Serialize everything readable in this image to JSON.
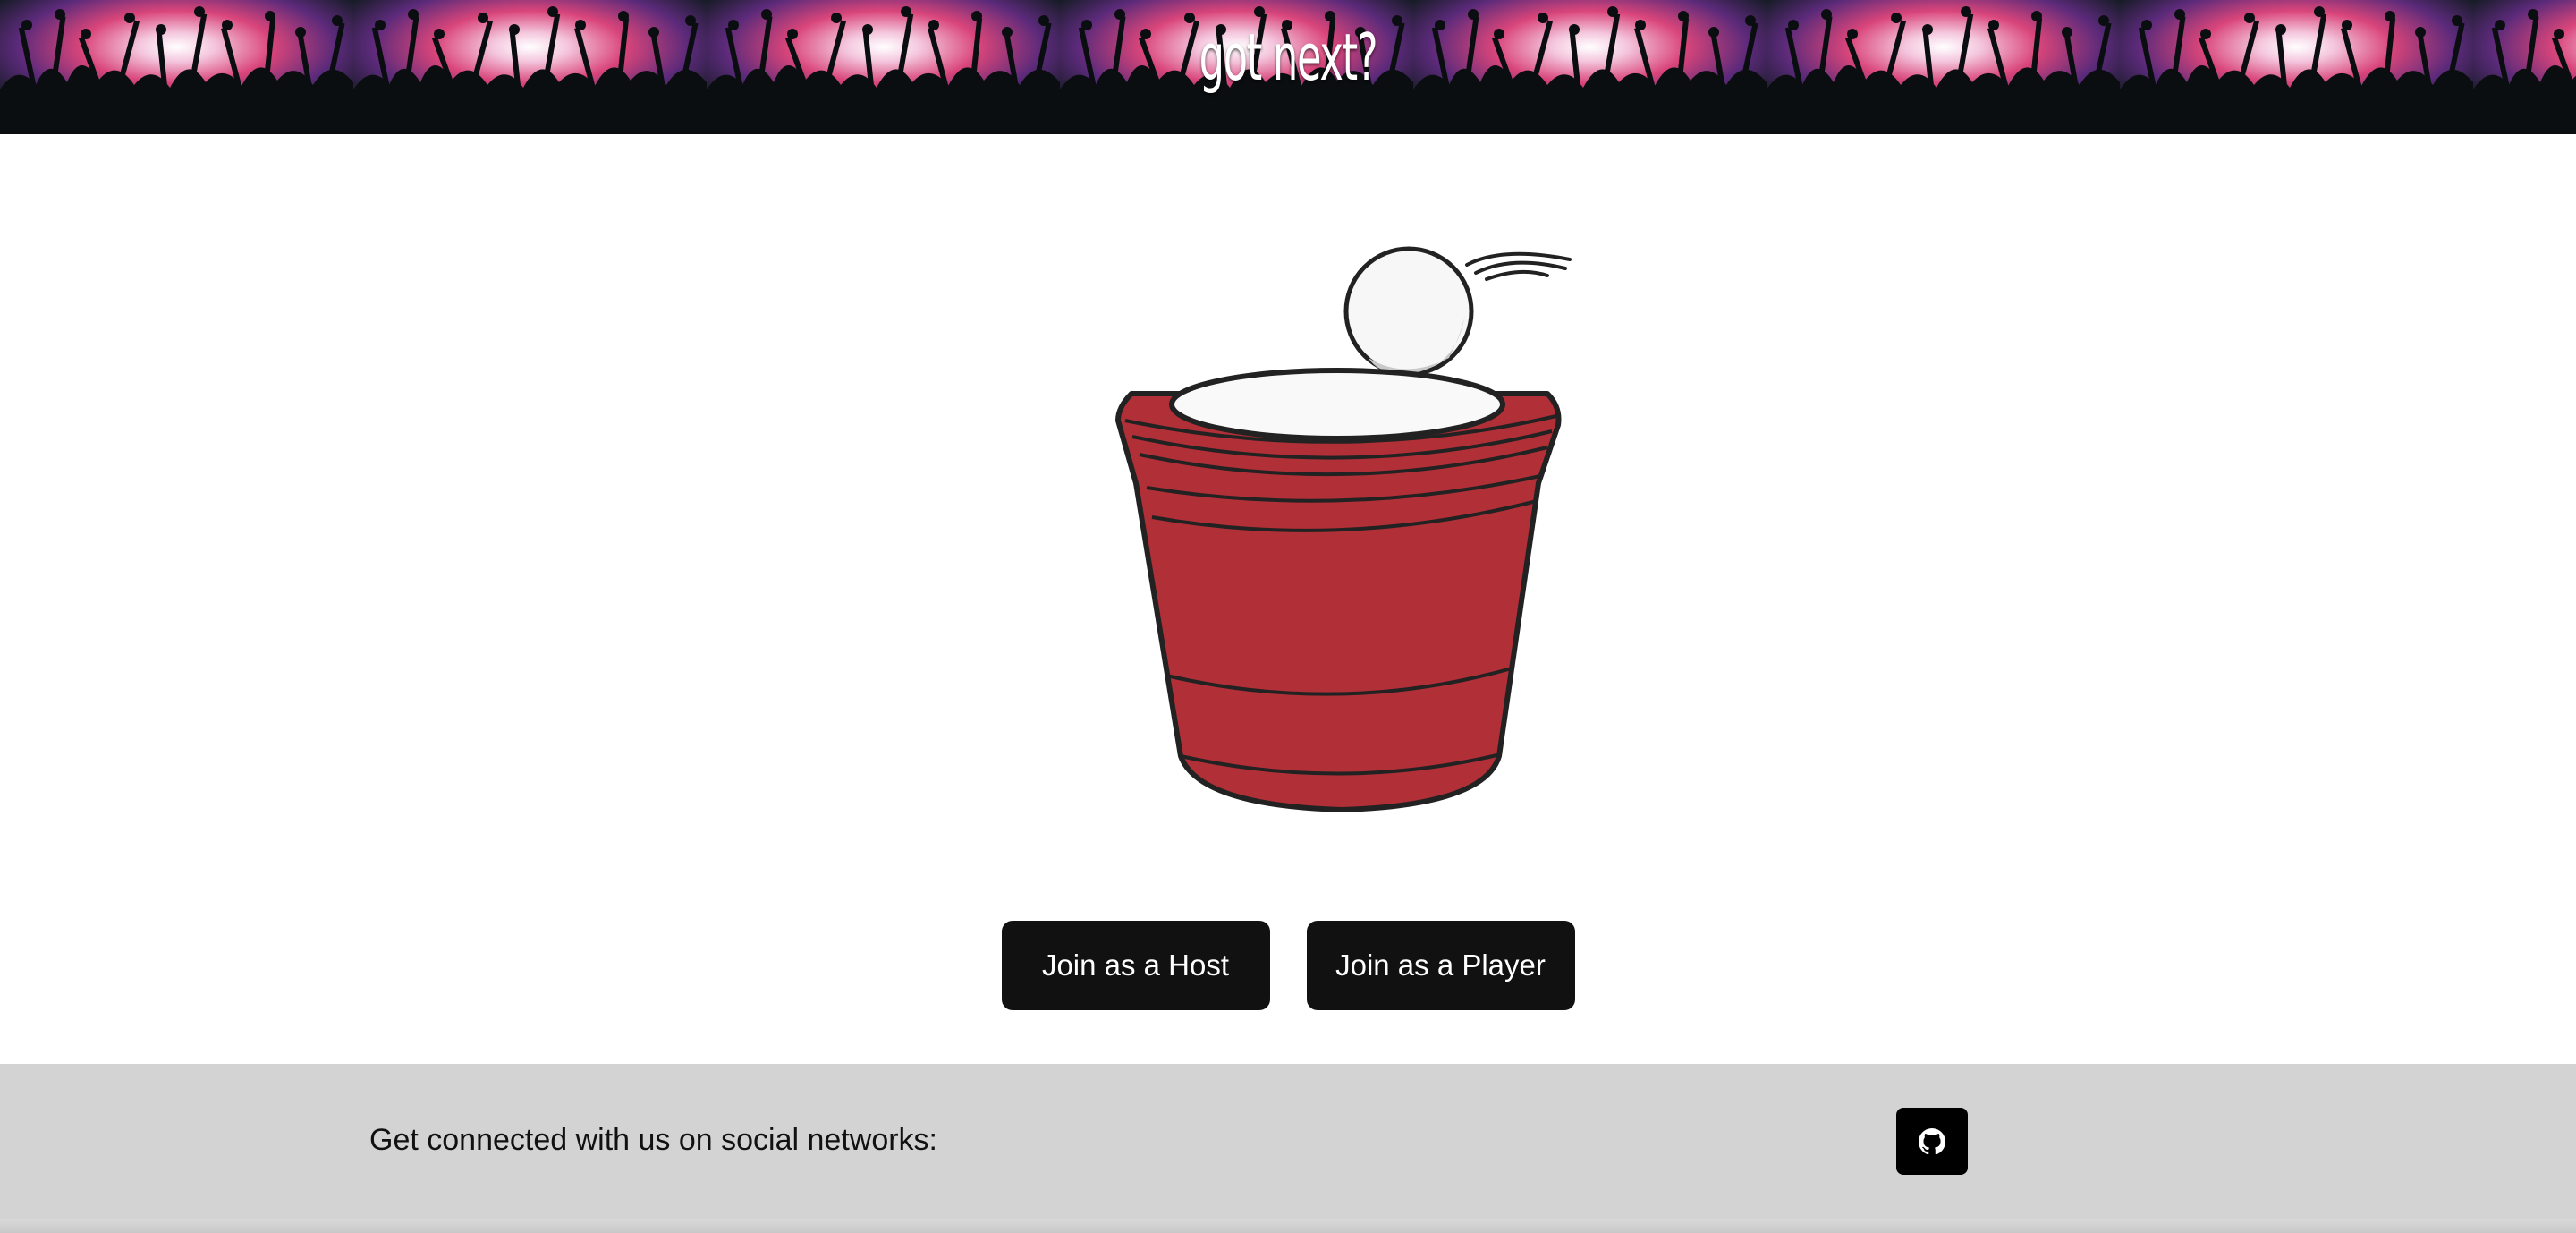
{
  "header": {
    "brand": "got next?"
  },
  "hero": {
    "image": "red-cup-with-ping-pong-ball"
  },
  "actions": {
    "host_label": "Join as a Host",
    "player_label": "Join as a Player"
  },
  "footer": {
    "social_text": "Get connected with us on social networks:",
    "social_icons": [
      "github-icon"
    ]
  },
  "colors": {
    "button_bg": "#111111",
    "cup_red": "#b12f37",
    "footer_bg": "#d3d3d3"
  }
}
